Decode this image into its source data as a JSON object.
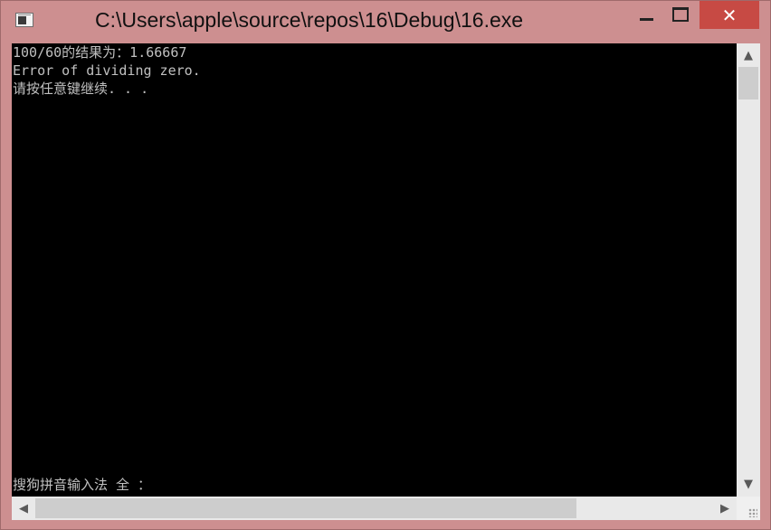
{
  "window": {
    "title": "C:\\Users\\apple\\source\\repos\\16\\Debug\\16.exe",
    "icon": "console-app-icon",
    "controls": {
      "minimize_icon": "minimize-icon",
      "maximize_icon": "maximize-icon",
      "close_label": "✕"
    }
  },
  "console": {
    "lines": [
      "100/60的结果为：1.66667",
      "Error of dividing zero.",
      "请按任意键继续. . ."
    ],
    "ime_status": "搜狗拼音输入法 全 ："
  },
  "scrollbars": {
    "up_arrow": "▲",
    "down_arrow": "▼",
    "left_arrow": "◀",
    "right_arrow": "▶"
  },
  "colors": {
    "frame": "#cd8f90",
    "close_button": "#c74a44",
    "console_bg": "#000000",
    "console_text": "#c0c0c0"
  }
}
